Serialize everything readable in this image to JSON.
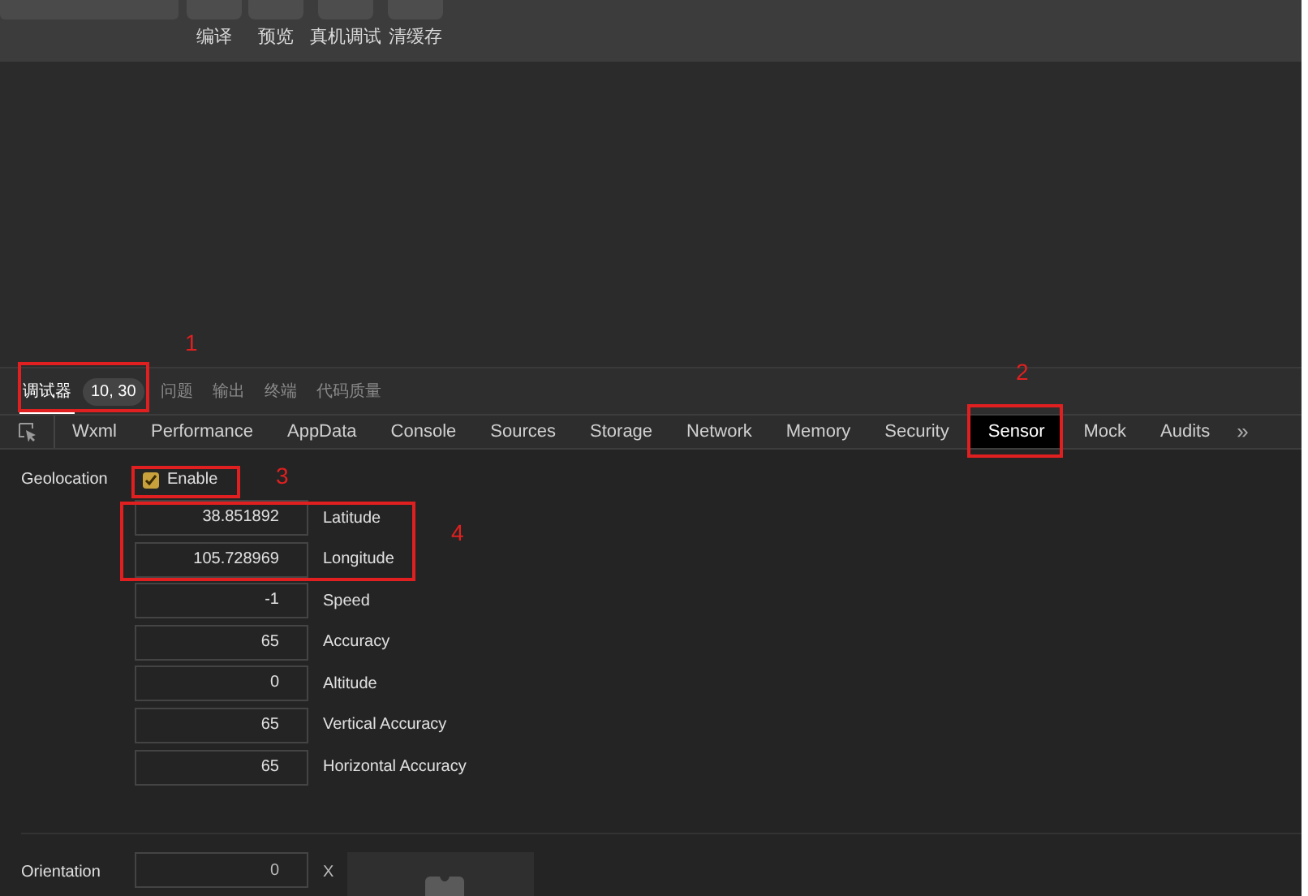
{
  "toolbar": {
    "buttons": [
      {
        "label": "编译"
      },
      {
        "label": "预览"
      },
      {
        "label": "真机调试"
      },
      {
        "label": "清缓存"
      }
    ]
  },
  "panel_tabs": {
    "items": [
      {
        "label": "调试器",
        "selected": true,
        "badge": "10, 30"
      },
      {
        "label": "问题",
        "selected": false
      },
      {
        "label": "输出",
        "selected": false
      },
      {
        "label": "终端",
        "selected": false
      },
      {
        "label": "代码质量",
        "selected": false
      }
    ]
  },
  "devtools_tabs": {
    "items": [
      {
        "label": "Wxml",
        "selected": false
      },
      {
        "label": "Performance",
        "selected": false
      },
      {
        "label": "AppData",
        "selected": false
      },
      {
        "label": "Console",
        "selected": false
      },
      {
        "label": "Sources",
        "selected": false
      },
      {
        "label": "Storage",
        "selected": false
      },
      {
        "label": "Network",
        "selected": false
      },
      {
        "label": "Memory",
        "selected": false
      },
      {
        "label": "Security",
        "selected": false
      },
      {
        "label": "Sensor",
        "selected": true
      },
      {
        "label": "Mock",
        "selected": false
      },
      {
        "label": "Audits",
        "selected": false
      }
    ],
    "more": "»"
  },
  "geolocation": {
    "label": "Geolocation",
    "enable": {
      "label": "Enable",
      "checked": true
    },
    "fields": [
      {
        "value": "38.851892",
        "label": "Latitude"
      },
      {
        "value": "105.728969",
        "label": "Longitude"
      },
      {
        "value": "-1",
        "label": "Speed"
      },
      {
        "value": "65",
        "label": "Accuracy"
      },
      {
        "value": "0",
        "label": "Altitude"
      },
      {
        "value": "65",
        "label": "Vertical Accuracy"
      },
      {
        "value": "65",
        "label": "Horizontal Accuracy"
      }
    ]
  },
  "orientation": {
    "label": "Orientation",
    "value": "0",
    "axis": "X"
  },
  "annotations": [
    {
      "number": "1"
    },
    {
      "number": "2"
    },
    {
      "number": "3"
    },
    {
      "number": "4"
    }
  ]
}
